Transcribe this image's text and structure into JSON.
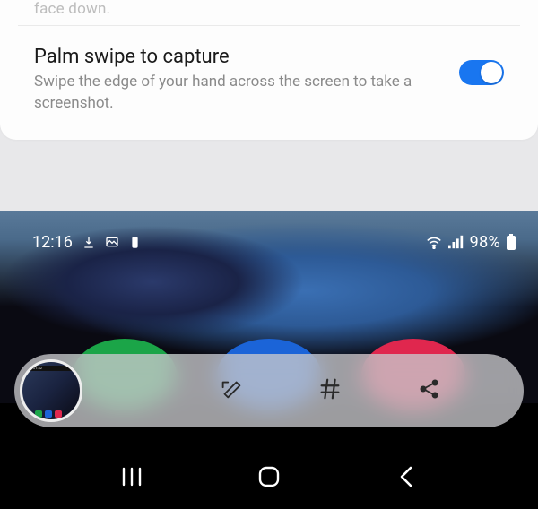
{
  "partial_setting_text": "face down.",
  "setting": {
    "title": "Palm swipe to capture",
    "description": "Swipe the edge of your hand across the screen to take a screenshot.",
    "enabled": true
  },
  "status_bar": {
    "time": "12:16",
    "battery_text": "98%"
  },
  "icons": {
    "download": "download-icon",
    "picture": "picture-icon",
    "clock": "clock-icon",
    "wifi": "wifi-icon",
    "signal": "signal-icon",
    "battery": "battery-icon",
    "edit": "edit-icon",
    "hashtag": "hashtag-icon",
    "share": "share-icon",
    "recents": "recents-icon",
    "home": "home-icon",
    "back": "back-icon"
  }
}
